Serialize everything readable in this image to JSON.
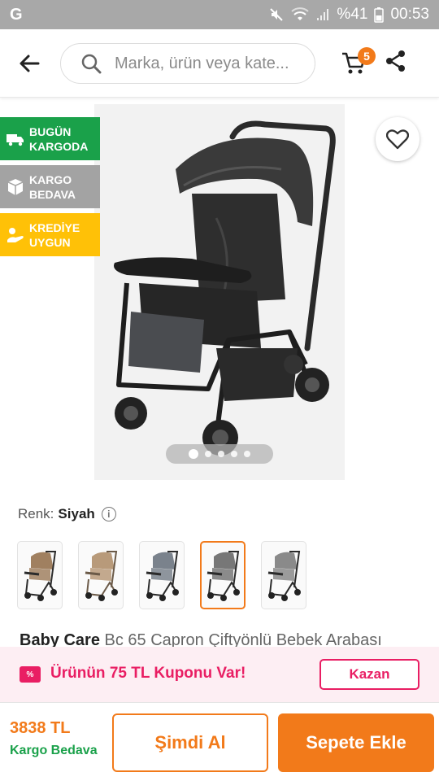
{
  "status_bar": {
    "app_icon": "G",
    "battery": "%41",
    "time": "00:53",
    "icons": [
      "mute-icon",
      "wifi-icon",
      "signal-icon",
      "battery-icon"
    ]
  },
  "header": {
    "search_placeholder": "Marka, ürün veya kate...",
    "cart_count": "5"
  },
  "badges": [
    {
      "line1": "BUGÜN",
      "line2": "KARGODA",
      "icon": "truck-icon",
      "color": "#1aa14a"
    },
    {
      "line1": "KARGO",
      "line2": "BEDAVA",
      "icon": "box-icon",
      "color": "#a3a3a3"
    },
    {
      "line1": "KREDİYE",
      "line2": "UYGUN",
      "icon": "credit-hand-icon",
      "color": "#ffc107"
    }
  ],
  "gallery": {
    "total_images": 5,
    "active_index": 0
  },
  "color": {
    "label": "Renk:",
    "value": "Siyah"
  },
  "variants": [
    {
      "frame": "#2b2b2b",
      "fabric": "#a08060",
      "selected": false
    },
    {
      "frame": "#6b5a48",
      "fabric": "#b89a7a",
      "selected": false
    },
    {
      "frame": "#2b2b2b",
      "fabric": "#7a828c",
      "selected": false
    },
    {
      "frame": "#2b2b2b",
      "fabric": "#777777",
      "selected": true
    },
    {
      "frame": "#2b2b2b",
      "fabric": "#8a8a8a",
      "selected": false
    }
  ],
  "product": {
    "brand": "Baby Care",
    "name": "Bc 65 Capron Çiftyönlü Bebek Arabası"
  },
  "coupon": {
    "text": "Ürünün 75 TL Kuponu Var!",
    "button": "Kazan",
    "icon_glyph": "%"
  },
  "bottom": {
    "price": "3838 TL",
    "cargo": "Kargo Bedava",
    "buy_now": "Şimdi Al",
    "add_to_cart": "Sepete Ekle"
  },
  "colors": {
    "accent": "#f27a1a",
    "green": "#1aa14a",
    "pink": "#e91e63"
  }
}
